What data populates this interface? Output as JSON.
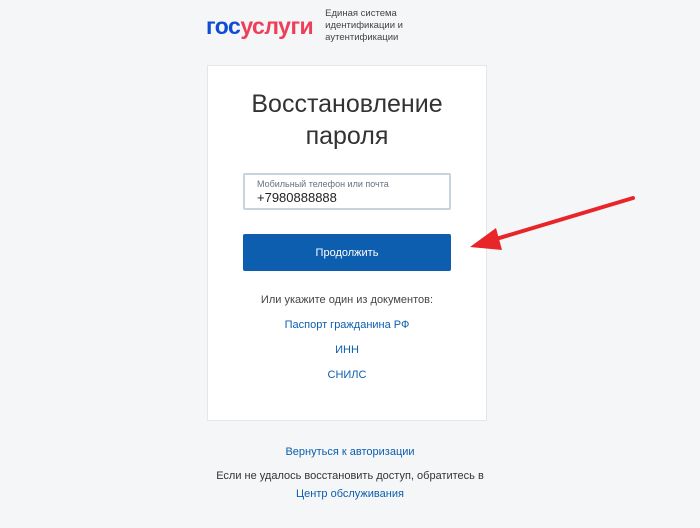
{
  "header": {
    "logo_part1": "гос",
    "logo_part2": "услуги",
    "tagline": "Единая система идентификации и аутентификации"
  },
  "card": {
    "title": "Восстановление пароля",
    "field": {
      "label": "Мобильный телефон или почта",
      "value": "+7980888888"
    },
    "continue_button": "Продолжить",
    "documents_hint": "Или укажите один из документов:",
    "documents": [
      "Паспорт гражданина РФ",
      "ИНН",
      "СНИЛС"
    ]
  },
  "footer": {
    "back_link": "Вернуться к авторизации",
    "help_text": "Если не удалось восстановить доступ, обратитесь в",
    "service_link": "Центр обслуживания"
  },
  "colors": {
    "brand_blue": "#0d4cd3",
    "brand_red": "#ee3f58",
    "button": "#0d5eae",
    "link": "#0d5eae",
    "annotation_arrow": "#e8262a"
  },
  "annotation": {
    "icon": "red-arrow-icon"
  }
}
